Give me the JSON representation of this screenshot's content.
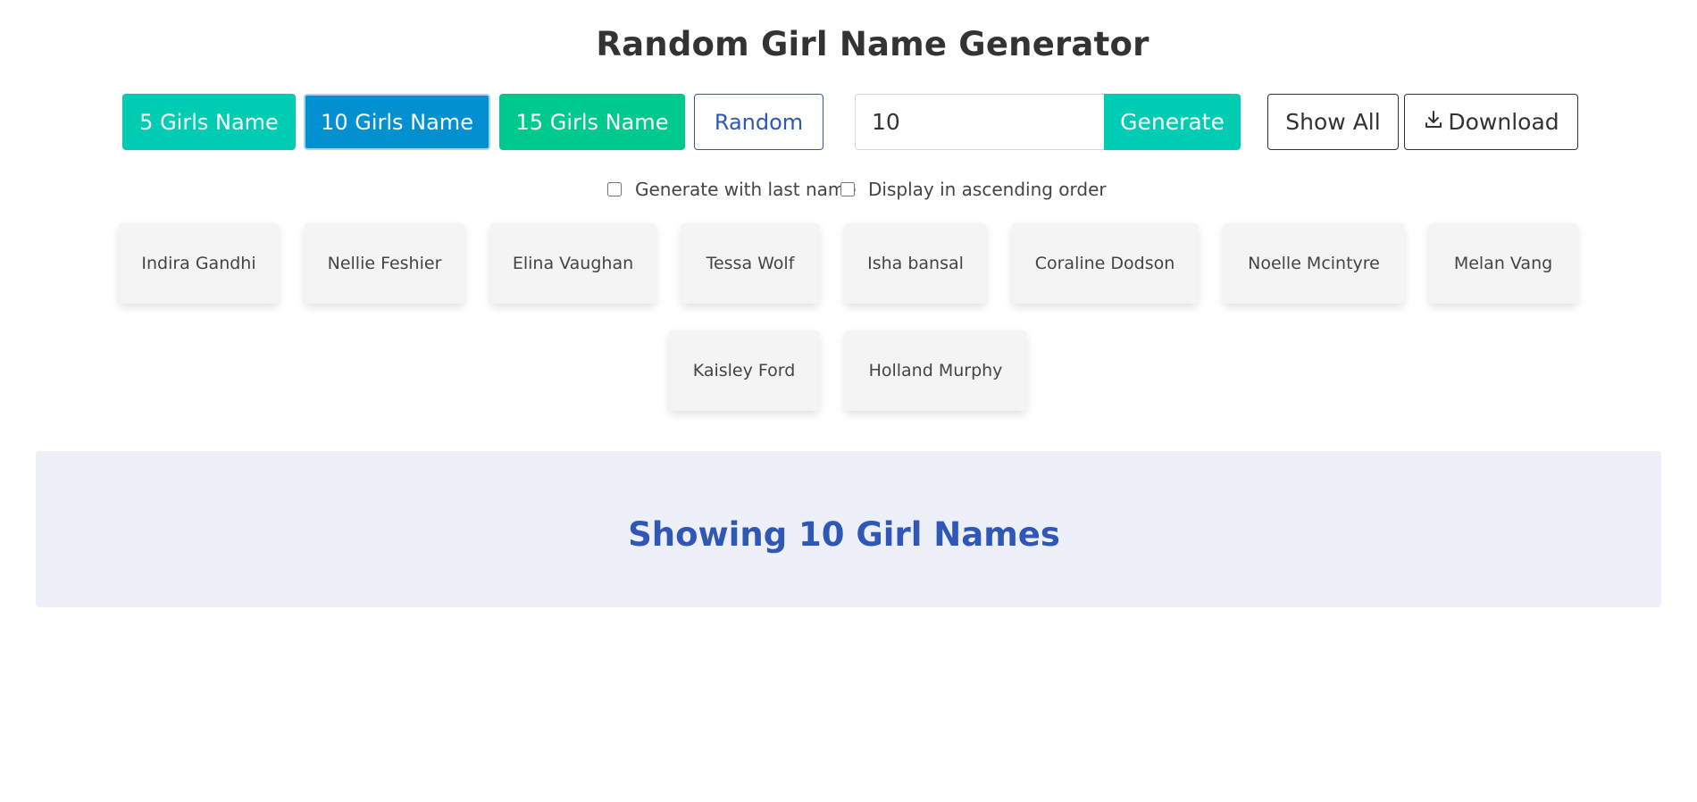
{
  "title": "Random Girl Name Generator",
  "toolbar": {
    "btn_5": "5 Girls Name",
    "btn_10": "10 Girls Name",
    "btn_15": "15 Girls Name",
    "btn_random": "Random",
    "count_value": "10",
    "btn_generate": "Generate",
    "btn_show_all": "Show All",
    "btn_download": "Download",
    "download_icon": "download-icon",
    "active_button": "10 Girls Name"
  },
  "options": {
    "last_name_label": "Generate with last name",
    "last_name_checked": false,
    "ascending_label": "Display in ascending order",
    "ascending_checked": false
  },
  "names": [
    "Indira Gandhi",
    "Nellie Feshier",
    "Elina Vaughan",
    "Tessa Wolf",
    "Isha bansal",
    "Coraline Dodson",
    "Noelle Mcintyre",
    "Melan Vang",
    "Kaisley Ford",
    "Holland Murphy"
  ],
  "banner": {
    "text": "Showing 10 Girl Names"
  },
  "colors": {
    "teal": "#00ccb4",
    "blue": "#0290d0",
    "green": "#00c98e",
    "link_blue": "#2f57b7",
    "banner_bg": "#edf0f9",
    "card_bg": "#f4f4f4"
  }
}
